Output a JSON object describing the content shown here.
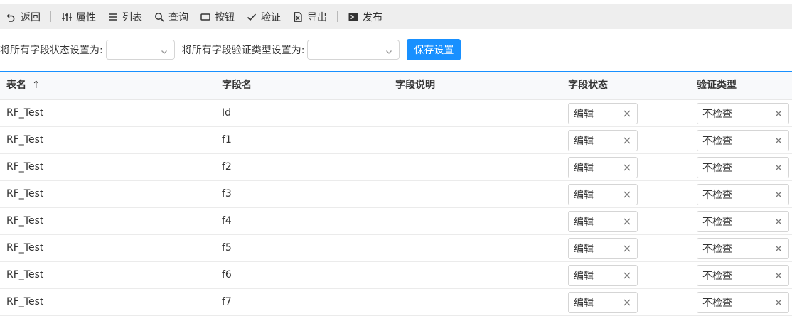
{
  "toolbar": {
    "back_label": "返回",
    "properties_label": "属性",
    "list_label": "列表",
    "query_label": "查询",
    "button_label": "按钮",
    "validate_label": "验证",
    "export_label": "导出",
    "publish_label": "发布"
  },
  "settings": {
    "status_label": "将所有字段状态设置为:",
    "status_value": "",
    "validation_label": "将所有字段验证类型设置为:",
    "validation_value": "",
    "save_label": "保存设置"
  },
  "grid": {
    "columns": {
      "table_name": "表名",
      "field_name": "字段名",
      "field_desc": "字段说明",
      "field_status": "字段状态",
      "validation_type": "验证类型"
    },
    "sort_indicator": "↑",
    "rows": [
      {
        "table": "RF_Test",
        "field": "Id",
        "desc": "",
        "status": "编辑",
        "validation": "不检查"
      },
      {
        "table": "RF_Test",
        "field": "f1",
        "desc": "",
        "status": "编辑",
        "validation": "不检查"
      },
      {
        "table": "RF_Test",
        "field": "f2",
        "desc": "",
        "status": "编辑",
        "validation": "不检查"
      },
      {
        "table": "RF_Test",
        "field": "f3",
        "desc": "",
        "status": "编辑",
        "validation": "不检查"
      },
      {
        "table": "RF_Test",
        "field": "f4",
        "desc": "",
        "status": "编辑",
        "validation": "不检查"
      },
      {
        "table": "RF_Test",
        "field": "f5",
        "desc": "",
        "status": "编辑",
        "validation": "不检查"
      },
      {
        "table": "RF_Test",
        "field": "f6",
        "desc": "",
        "status": "编辑",
        "validation": "不检查"
      },
      {
        "table": "RF_Test",
        "field": "f7",
        "desc": "",
        "status": "编辑",
        "validation": "不检查"
      }
    ]
  },
  "colors": {
    "accent": "#1890ff",
    "toolbar_bg": "#eeeeee",
    "header_bg": "#f8f9fb"
  }
}
